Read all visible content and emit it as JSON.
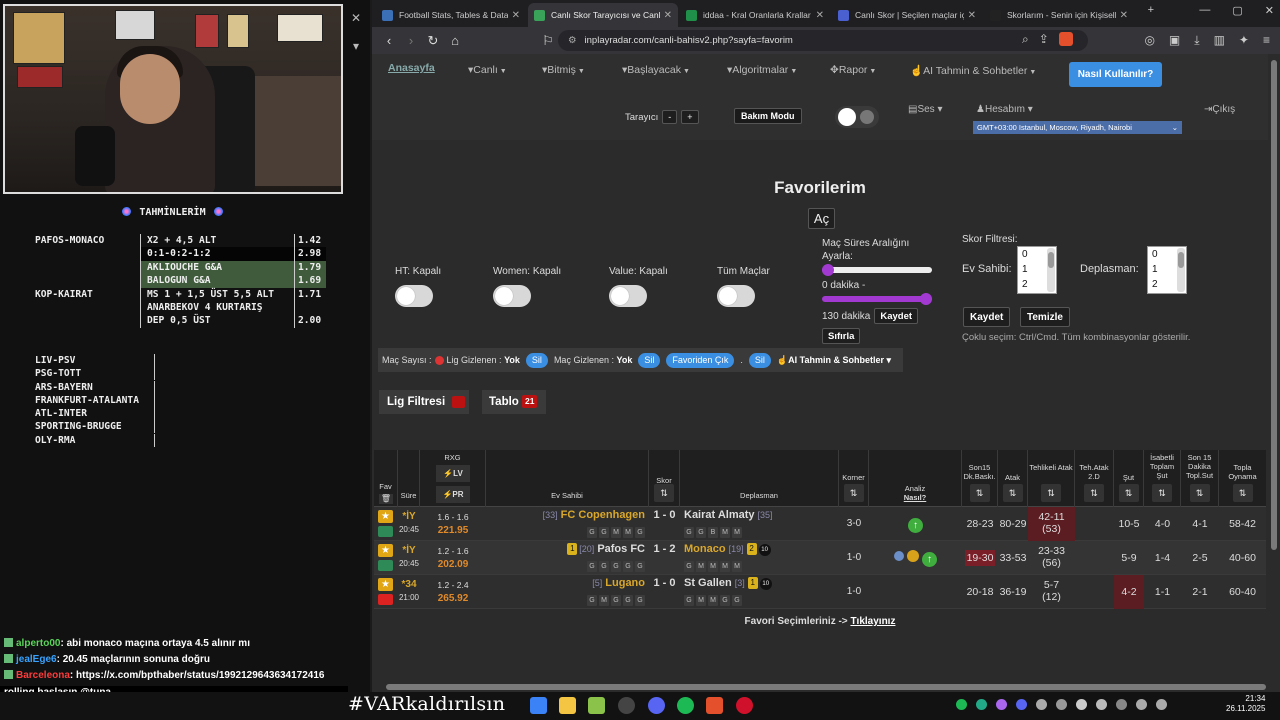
{
  "stream": {
    "tahmin_title": "TAHMİNLERİM",
    "bets": [
      {
        "match": "PAFOS-MONACO",
        "bet": "X2 + 4,5 ALT",
        "odd": "1.42",
        "style": ""
      },
      {
        "match": "",
        "bet": "0:1-0:2-1:2",
        "odd": "2.98",
        "style": "dark"
      },
      {
        "match": "",
        "bet": "AKLIOUCHE G&A",
        "odd": "1.79",
        "style": "hl"
      },
      {
        "match": "",
        "bet": "BALOGUN G&A",
        "odd": "1.69",
        "style": "hl"
      },
      {
        "match": "KOP-KAIRAT",
        "bet": "MS 1 + 1,5 ÜST 5,5 ALT",
        "odd": "1.71",
        "style": ""
      },
      {
        "match": "",
        "bet": "ANARBEKOV 4 KURTARIŞ",
        "odd": "",
        "style": ""
      },
      {
        "match": "",
        "bet": "DEP 0,5 ÜST",
        "odd": "2.00",
        "style": ""
      }
    ],
    "matches": [
      "LIV-PSV",
      "PSG-TOTT",
      "ARS-BAYERN",
      "FRANKFURT-ATALANTA",
      "ATL-INTER",
      "SPORTING-BRUGGE",
      "OLY-RMA"
    ],
    "chat": [
      {
        "user": "alperto00",
        "msg": ": abi monaco maçına ortaya 4.5 alınır mı",
        "cls": "u1"
      },
      {
        "user": "jealEge6",
        "msg": ": 20.45 maçlarının sonuna doğru",
        "cls": "u2"
      },
      {
        "user": "Barceleona",
        "msg": ": https://x.com/bpthaber/status/1992129643634172416",
        "cls": "u3"
      }
    ],
    "ticker": "rolling başlasın @tuna",
    "hashtag": "#VARkaldırılsın"
  },
  "browser": {
    "tabs": [
      {
        "title": "Football Stats, Tables & Data | Soc",
        "color": "#3b6fb6",
        "active": false
      },
      {
        "title": "Canlı Skor Tarayıcısı ve Canlı İ",
        "color": "#3aa35a",
        "active": true
      },
      {
        "title": "iddaa - Kral Oranlarla Krallar Gibi",
        "color": "#1f8f4a",
        "active": false
      },
      {
        "title": "Canlı Skor | Seçilen maçlar için ca",
        "color": "#4a5fd0",
        "active": false
      },
      {
        "title": "Skorlarım - Senin için Kişiselleştir",
        "color": "#222222",
        "active": false
      }
    ],
    "url": "inplayradar.com/canli-bahisv2.php?sayfa=favorim"
  },
  "site": {
    "menu": {
      "home": "Anasayfa",
      "items": [
        "Canlı",
        "Bitmiş",
        "Başlayacak",
        "Algoritmalar",
        "Rapor",
        "AI Tahmin & Sohbetler"
      ],
      "help": "Nasıl Kullanılır?",
      "tarayici": "Tarayıcı",
      "minus": "-",
      "plus": "+",
      "bakim": "Bakım Modu",
      "ses": "Ses",
      "hesap": "Hesabım",
      "cikis": "Çıkış",
      "timezone": "GMT+03:00 Istanbul, Moscow, Riyadh, Nairobi"
    },
    "title": "Favorilerim",
    "ac": "Aç",
    "toggles": [
      "HT: Kapalı",
      "Women: Kapalı",
      "Value: Kapalı",
      "Tüm Maçlar"
    ],
    "range": {
      "label1": "Maç Süres Aralığını",
      "label2": "Ayarla:",
      "min_text": "0 dakika -",
      "max_text": "130 dakika",
      "min_value": 0,
      "max_value": 130,
      "save": "Kaydet",
      "reset": "Sıfırla"
    },
    "skor_filter": {
      "title": "Skor Filtresi:",
      "home_label": "Ev Sahibi:",
      "away_label": "Deplasman:",
      "options": [
        "0",
        "1",
        "2"
      ],
      "save": "Kaydet",
      "clear": "Temizle",
      "hint": "Çoklu seçim: Ctrl/Cmd. Tüm kombinasyonlar gösterilir."
    },
    "filterbar": {
      "mac_sayisi": "Maç Sayısı :",
      "lig_gizlenen": "Lig Gizlenen :",
      "yok1": "Yok",
      "sil1": "Sil",
      "mac_gizlenen": "Maç Gizlenen :",
      "yok2": "Yok",
      "sil2": "Sil",
      "favoriden": "Favoriden Çık",
      "dot": ".",
      "sil3": "Sil",
      "ai": "AI Tahmin & Sohbetler"
    },
    "lig_filtresi": "Lig Filtresi",
    "tablo": "Tablo",
    "tablo_count": "21",
    "table": {
      "headers": {
        "fav": "Fav",
        "sure": "Süre",
        "rxg": "RXG",
        "lv": "LV",
        "pr": "PR",
        "home": "Ev Sahibi",
        "skor": "Skor",
        "away": "Deplasman",
        "korner": "Korner",
        "analiz": "Analiz",
        "nasil": "Nasıl?",
        "son15": "Son15 Dk.Baskı.",
        "atak": "Atak",
        "tehlikeli": "Tehlikeli Atak",
        "tehatak": "Teh.Atak 2.D",
        "sut": "Şut",
        "isabetli": "İsabetli Toplam Şut",
        "son15sut": "Son 15 Dakika Topl.Sut",
        "topla": "Topla Oynama"
      },
      "rows": [
        {
          "period": "*İY",
          "time": "20:45",
          "rxg": "1.6 - 1.6",
          "rxg2": "221.95",
          "home_rank": "[33]",
          "home": "FC Copenhagen",
          "home_hi": true,
          "home_chip": "",
          "score": "1 - 0",
          "away": "Kairat Almaty",
          "away_rank": "[35]",
          "away_hi": false,
          "away_chip": "",
          "away_chip2": "",
          "home_form": [
            "G",
            "G",
            "M",
            "M",
            "G"
          ],
          "away_form": [
            "G",
            "G",
            "B",
            "M",
            "M"
          ],
          "corner": "3-0",
          "analiz": "up",
          "son15": "28-23",
          "atak": "80-29",
          "tehlikeli": "42-11",
          "tehlikeli2": "(53)",
          "tehatak": "",
          "sut": "10-5",
          "isabetli": "4-0",
          "son15sut": "4-1",
          "topla": "58-42",
          "red_son15": false,
          "red_tehlikeli": true,
          "red_sut": false,
          "flag": "#2e8b57"
        },
        {
          "period": "*İY",
          "time": "20:45",
          "rxg": "1.2 - 1.6",
          "rxg2": "202.09",
          "home_rank": "[20]",
          "home": "Pafos FC",
          "home_hi": false,
          "home_chip": "1",
          "score": "1 - 2",
          "away": "Monaco",
          "away_rank": "[19]",
          "away_hi": true,
          "away_chip": "2",
          "away_chip2": "10",
          "home_form": [
            "G",
            "G",
            "G",
            "G",
            "G"
          ],
          "away_form": [
            "G",
            "M",
            "M",
            "M",
            "M"
          ],
          "corner": "1-0",
          "analiz": "all",
          "son15": "19-30",
          "atak": "33-53",
          "tehlikeli": "23-33",
          "tehlikeli2": "(56)",
          "tehatak": "",
          "sut": "5-9",
          "isabetli": "1-4",
          "son15sut": "2-5",
          "topla": "40-60",
          "red_son15": true,
          "red_tehlikeli": false,
          "red_sut": false,
          "flag": "#2e8b57"
        },
        {
          "period": "*34",
          "time": "21:00",
          "rxg": "1.2 - 2.4",
          "rxg2": "265.92",
          "home_rank": "[5]",
          "home": "Lugano",
          "home_hi": true,
          "home_chip": "",
          "score": "1 - 0",
          "away": "St Gallen",
          "away_rank": "[3]",
          "away_hi": false,
          "away_chip": "1",
          "away_chip2": "10",
          "home_form": [
            "G",
            "M",
            "G",
            "G",
            "G"
          ],
          "away_form": [
            "G",
            "M",
            "M",
            "G",
            "G"
          ],
          "corner": "1-0",
          "analiz": "",
          "son15": "20-18",
          "atak": "36-19",
          "tehlikeli": "5-7",
          "tehlikeli2": "(12)",
          "tehatak": "",
          "sut": "4-2",
          "isabetli": "1-1",
          "son15sut": "2-1",
          "topla": "60-40",
          "red_son15": false,
          "red_tehlikeli": false,
          "red_sut": true,
          "flag": "#d22"
        }
      ],
      "footer_text": "Favori Seçimleriniz ->",
      "footer_link": "Tıklayınız"
    }
  },
  "clock": {
    "time": "21:34",
    "date": "26.11.2025"
  }
}
